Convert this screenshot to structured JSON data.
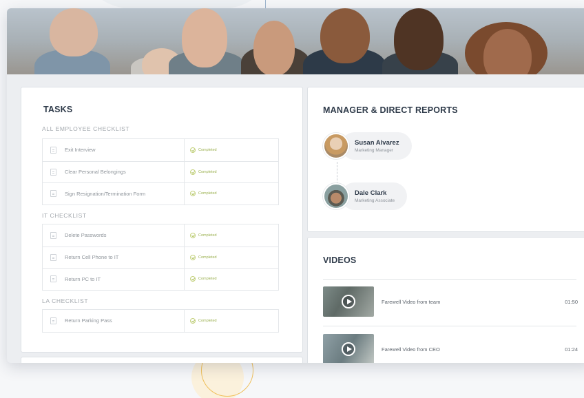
{
  "tasks": {
    "title": "TASKS",
    "checklists": [
      {
        "title": "ALL EMPLOYEE CHECKLIST",
        "items": [
          {
            "name": "Exit Interview",
            "status": "Completed"
          },
          {
            "name": "Clear Personal Belongings",
            "status": "Completed"
          },
          {
            "name": "Sign Resignation/Termination Form",
            "status": "Completed"
          }
        ]
      },
      {
        "title": "IT CHECKLIST",
        "items": [
          {
            "name": "Delete Passwords",
            "status": "Completed"
          },
          {
            "name": "Return Cell Phone to IT",
            "status": "Completed"
          },
          {
            "name": "Return PC to IT",
            "status": "Completed"
          }
        ]
      },
      {
        "title": "LA CHECKLIST",
        "items": [
          {
            "name": "Return Parking Pass",
            "status": "Completed"
          }
        ]
      }
    ]
  },
  "manager": {
    "title": "MANAGER & DIRECT REPORTS",
    "people": [
      {
        "name": "Susan Alvarez",
        "title": "Marketing Manager"
      },
      {
        "name": "Dale Clark",
        "title": "Marketing Associate"
      }
    ]
  },
  "videos": {
    "title": "VIDEOS",
    "items": [
      {
        "title": "Farewell Video from  team",
        "duration": "01:50"
      },
      {
        "title": "Farewell Video from CEO",
        "duration": "01:24"
      }
    ]
  },
  "colors": {
    "accent_status": "#9bb050",
    "heading": "#2f3b4a"
  },
  "icons": [
    "document-icon",
    "check-circle-icon",
    "play-icon"
  ]
}
